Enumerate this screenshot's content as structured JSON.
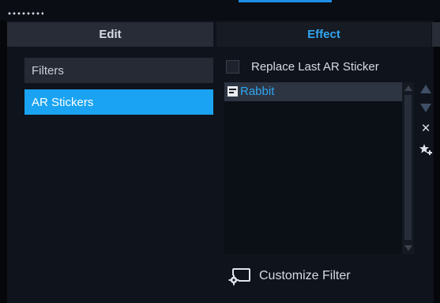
{
  "tabs": {
    "edit": "Edit",
    "effect": "Effect"
  },
  "left_list": {
    "filters": "Filters",
    "ar_stickers": "AR Stickers"
  },
  "options": {
    "replace_last_ar_sticker": "Replace Last AR Sticker",
    "replace_checked": false
  },
  "sticker_list": {
    "items": [
      {
        "label": "Rabbit",
        "selected": true
      }
    ]
  },
  "actions": {
    "customize_filter": "Customize Filter",
    "delete_glyph": "×"
  },
  "colors": {
    "accent": "#1aa3f2",
    "tab_active_text": "#31a6f0",
    "panel_bg": "#0f131b"
  },
  "icons": {
    "grip": "grip-dots-icon",
    "sticker": "sticker-icon",
    "move_up": "move-up-icon",
    "move_down": "move-down-icon",
    "delete": "close-icon",
    "effects": "effects-star-icon",
    "customize": "customize-filter-icon"
  }
}
